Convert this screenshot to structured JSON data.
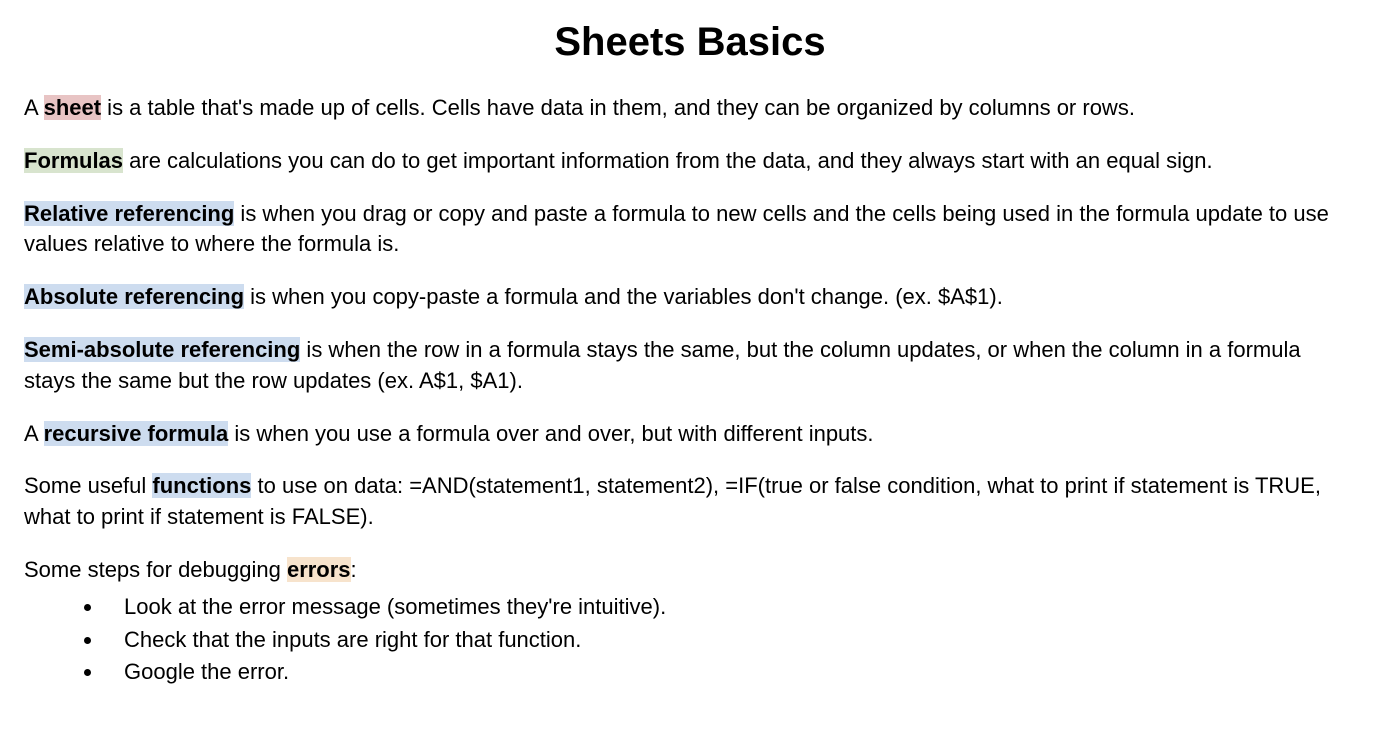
{
  "title": "Sheets Basics",
  "p1": {
    "pre": "A ",
    "term": "sheet",
    "post": " is a table that's made up of cells. Cells have data in them, and they can be organized by columns or rows."
  },
  "p2": {
    "term": "Formulas",
    "post": " are calculations you can do to get important information from the data, and they always start with an equal sign."
  },
  "p3": {
    "term": "Relative referencing",
    "post": " is when you drag or copy and paste a formula to new cells and the cells being used in the formula update to use values relative to where the formula is."
  },
  "p4": {
    "term": "Absolute referencing",
    "post": " is when you copy-paste a formula and the variables don't change. (ex. $A$1)."
  },
  "p5": {
    "term": "Semi-absolute referencing",
    "post": " is when the row in a formula stays the same, but the column updates, or when the column in a formula stays the same but the row updates (ex. A$1,  $A1)."
  },
  "p6": {
    "pre": "A ",
    "term": "recursive formula",
    "post": " is when you use a formula over and over, but with different inputs."
  },
  "p7": {
    "pre": "Some useful ",
    "term": "functions",
    "post": " to use on data: =AND(statement1, statement2), =IF(true or false condition, what to print if statement is TRUE, what to print if statement is FALSE)."
  },
  "p8": {
    "pre": "Some steps for debugging ",
    "term": "errors",
    "post": ":"
  },
  "bullets": [
    "Look at the error message (sometimes they're intuitive).",
    "Check that the inputs are right for that function.",
    "Google the error."
  ]
}
